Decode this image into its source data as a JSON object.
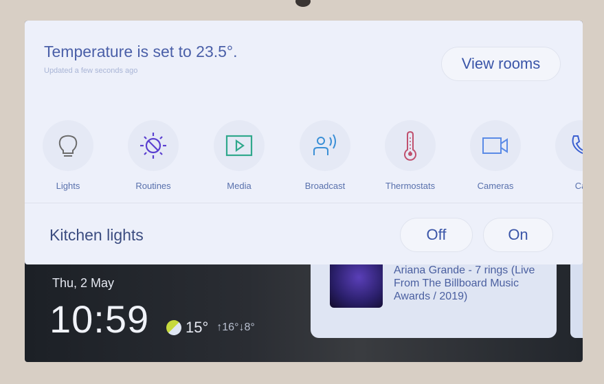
{
  "header": {
    "title": "Temperature is set to 23.5°.",
    "subtitle": "Updated a few seconds ago",
    "view_rooms_label": "View rooms"
  },
  "tiles": [
    {
      "label": "Lights",
      "icon": "lightbulb-icon",
      "color": "#6b6b6b"
    },
    {
      "label": "Routines",
      "icon": "routines-sun-moon-icon",
      "color": "#5a3fd0"
    },
    {
      "label": "Media",
      "icon": "media-play-icon",
      "color": "#2fa88c"
    },
    {
      "label": "Broadcast",
      "icon": "broadcast-icon",
      "color": "#3a8fd6"
    },
    {
      "label": "Thermostats",
      "icon": "thermometer-icon",
      "color": "#c0506e"
    },
    {
      "label": "Cameras",
      "icon": "camera-icon",
      "color": "#5a8ae6"
    },
    {
      "label": "Ca",
      "icon": "phone-icon",
      "color": "#3a5fd0"
    }
  ],
  "kitchen": {
    "label": "Kitchen lights",
    "off_label": "Off",
    "on_label": "On"
  },
  "ambient": {
    "date": "Thu, 2 May",
    "time": "10:59",
    "weather_icon": "partly-sunny-icon",
    "temperature": "15°",
    "range": "↑16°↓8°"
  },
  "media": {
    "track": "Ariana Grande - 7 rings (Live From The Billboard Music Awards / 2019)"
  }
}
